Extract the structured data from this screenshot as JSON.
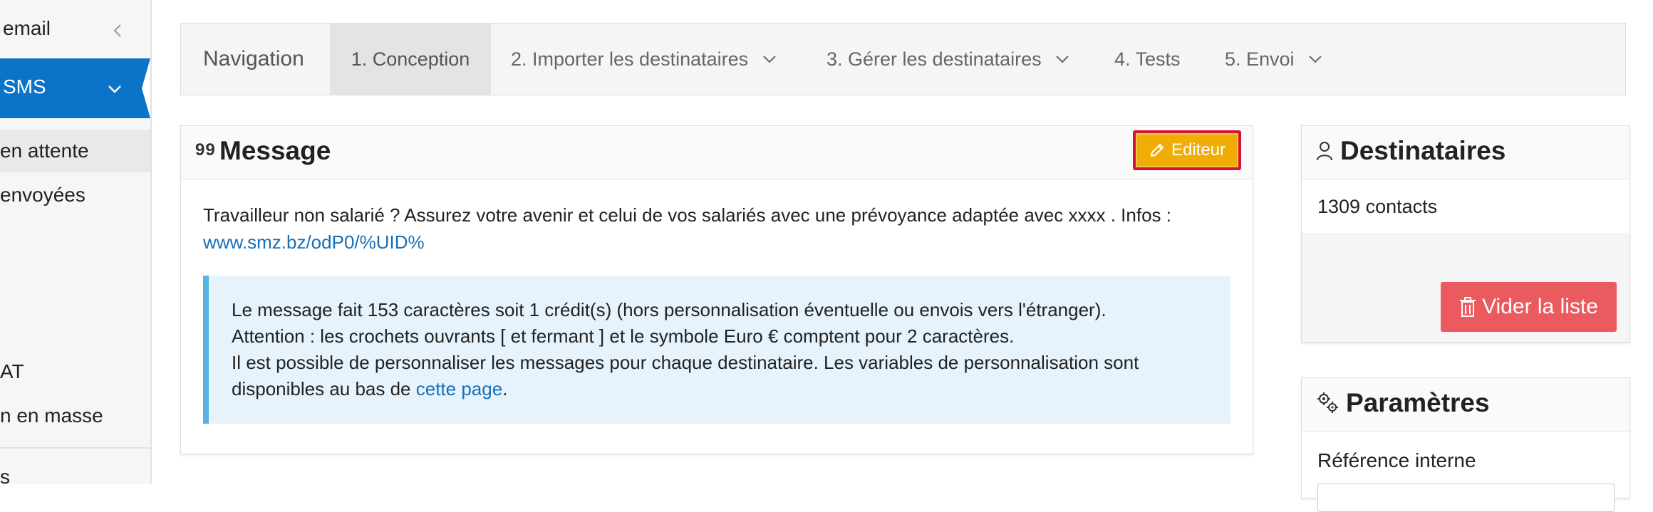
{
  "sidebar": {
    "header_label": "email",
    "active_section_label": "SMS",
    "items": [
      {
        "label": "en attente",
        "selected": true
      },
      {
        "label": "envoyées",
        "selected": false
      },
      {
        "label": "AT",
        "selected": false
      },
      {
        "label": "n en masse",
        "selected": false
      },
      {
        "label": "s",
        "selected": false
      }
    ]
  },
  "stepbar": {
    "title": "Navigation",
    "steps": [
      {
        "label": "1. Conception",
        "active": true,
        "dropdown": false
      },
      {
        "label": "2. Importer les destinataires",
        "active": false,
        "dropdown": true
      },
      {
        "label": "3. Gérer les destinataires",
        "active": false,
        "dropdown": true
      },
      {
        "label": "4. Tests",
        "active": false,
        "dropdown": false
      },
      {
        "label": "5. Envoi",
        "active": false,
        "dropdown": true
      }
    ]
  },
  "message_panel": {
    "quote_glyph": "99",
    "title": "Message",
    "editor_button_label": "Editeur",
    "body_text": "Travailleur non salarié ? Assurez votre avenir et celui de vos salariés avec une prévoyance adaptée avec xxxx . Infos :",
    "body_link": "www.smz.bz/odP0/%UID%",
    "info": {
      "line1": "Le message fait 153 caractères soit 1 crédit(s) (hors personnalisation éventuelle ou envois vers l'étranger).",
      "line2": "Attention : les crochets ouvrants [ et fermant ] et le symbole Euro € comptent pour 2 caractères.",
      "line3": "Il est possible de personnaliser les messages pour chaque destinataire. Les variables de personnalisation sont",
      "line4_prefix": "disponibles au bas de ",
      "line4_link": "cette page",
      "line4_suffix": "."
    }
  },
  "recipients_panel": {
    "title": "Destinataires",
    "contact_count": "1309 contacts",
    "clear_button_label": "Vider la liste"
  },
  "parameters_panel": {
    "title": "Paramètres",
    "internal_reference_label": "Référence interne"
  },
  "colors": {
    "sidebar_active": "#0b74c9",
    "editor_button": "#f0ad05",
    "editor_highlight": "#d41435",
    "clear_button": "#ea5a5f",
    "info_border": "#58b3e4",
    "info_background": "#e6f3fc",
    "link": "#1a6fb5"
  }
}
